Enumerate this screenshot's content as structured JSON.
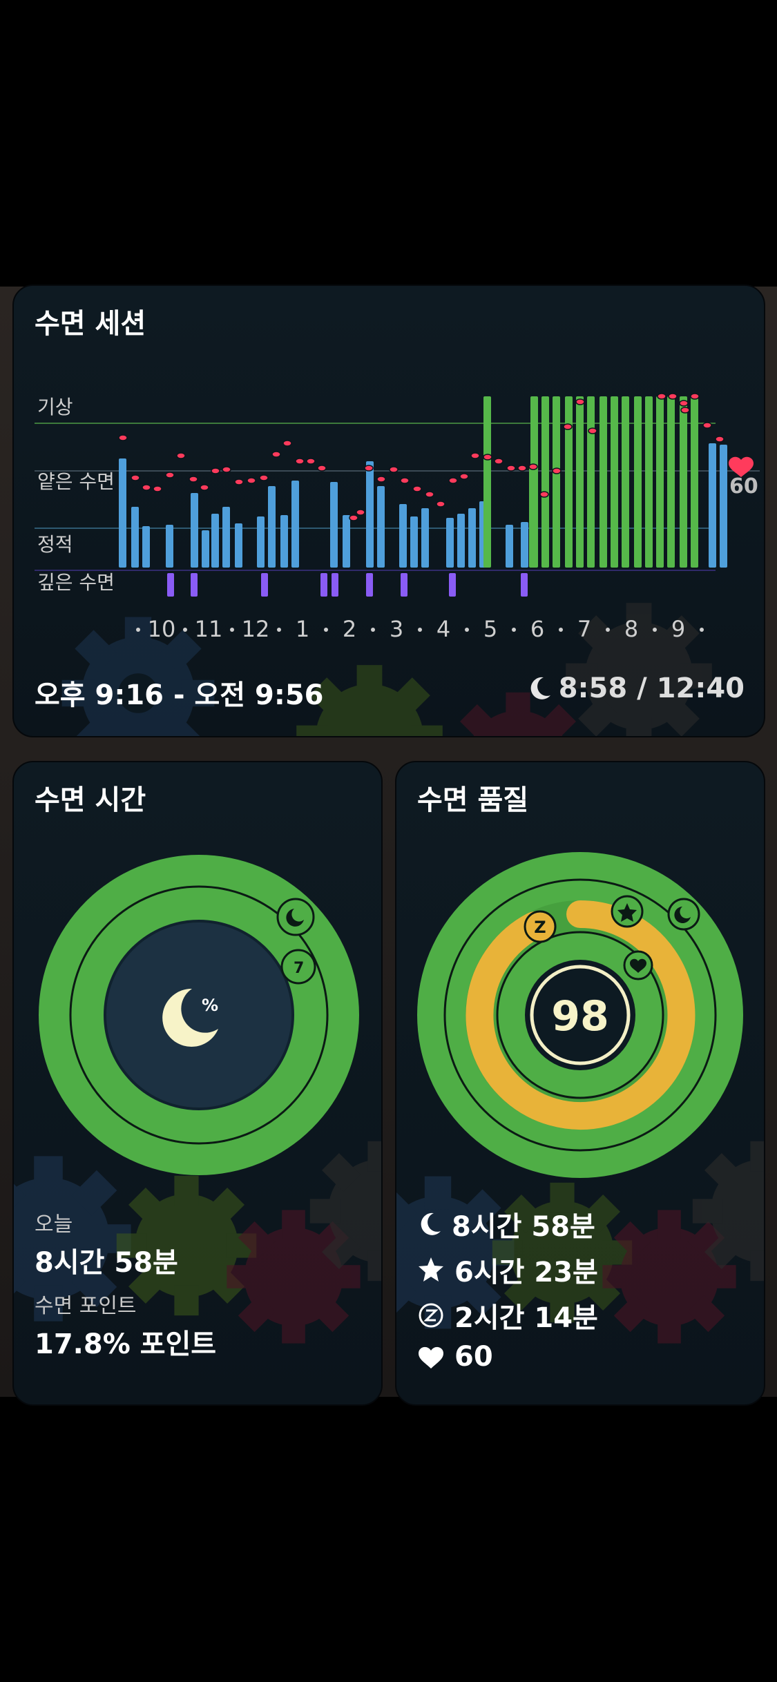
{
  "session_card": {
    "title": "수면 세션",
    "stage_labels": {
      "awake": "기상",
      "light": "얕은 수면",
      "still": "정적",
      "deep": "깊은 수면"
    },
    "hour_labels": [
      "10",
      "11",
      "12",
      "1",
      "2",
      "3",
      "4",
      "5",
      "6",
      "7",
      "8",
      "9"
    ],
    "heart_rate_now": "60",
    "time_range": "오후 9:16 - 오전 9:56",
    "duration": "8:58 / 12:40",
    "colors": {
      "awake_bar": "#56b84a",
      "light_bar": "#4f9fdb",
      "deep_bar": "#8a5cf5",
      "heart_dot": "#ff3b5c"
    }
  },
  "sleep_time_card": {
    "title": "수면 시간",
    "center_icon": "moon-percent-icon",
    "ring_badge": "7",
    "today_label": "오늘",
    "today_value": "8시간 58분",
    "points_label": "수면 포인트",
    "points_value": "17.8% 포인트"
  },
  "sleep_quality_card": {
    "title": "수면 품질",
    "score": "98",
    "ring_badge": "Z",
    "stats": [
      {
        "icon": "moon-icon",
        "value": "8시간 58분"
      },
      {
        "icon": "star-icon",
        "value": "6시간 23분"
      },
      {
        "icon": "z-circle-icon",
        "value": "2시간 14분"
      },
      {
        "icon": "heart-icon",
        "value": "60"
      }
    ]
  }
}
